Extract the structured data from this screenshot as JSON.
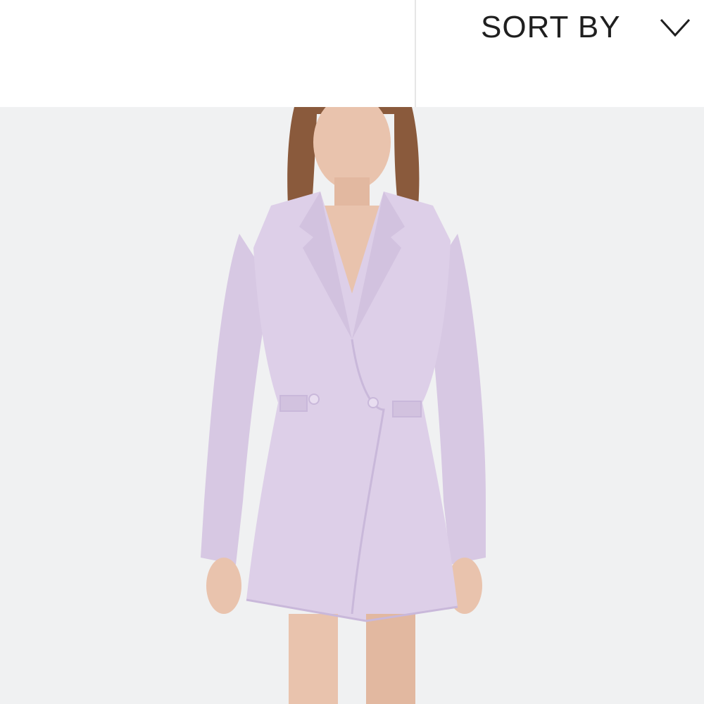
{
  "sort": {
    "label": "SORT BY",
    "icon": "chevron-down-icon"
  },
  "product": {
    "image_description_icon": "product-photo",
    "colors": {
      "background": "#f0f1f2",
      "garment": "#ddcfe8",
      "garment_shadow": "#c9b8da",
      "skin": "#e9c3ad",
      "hair": "#8a5a3c"
    }
  }
}
